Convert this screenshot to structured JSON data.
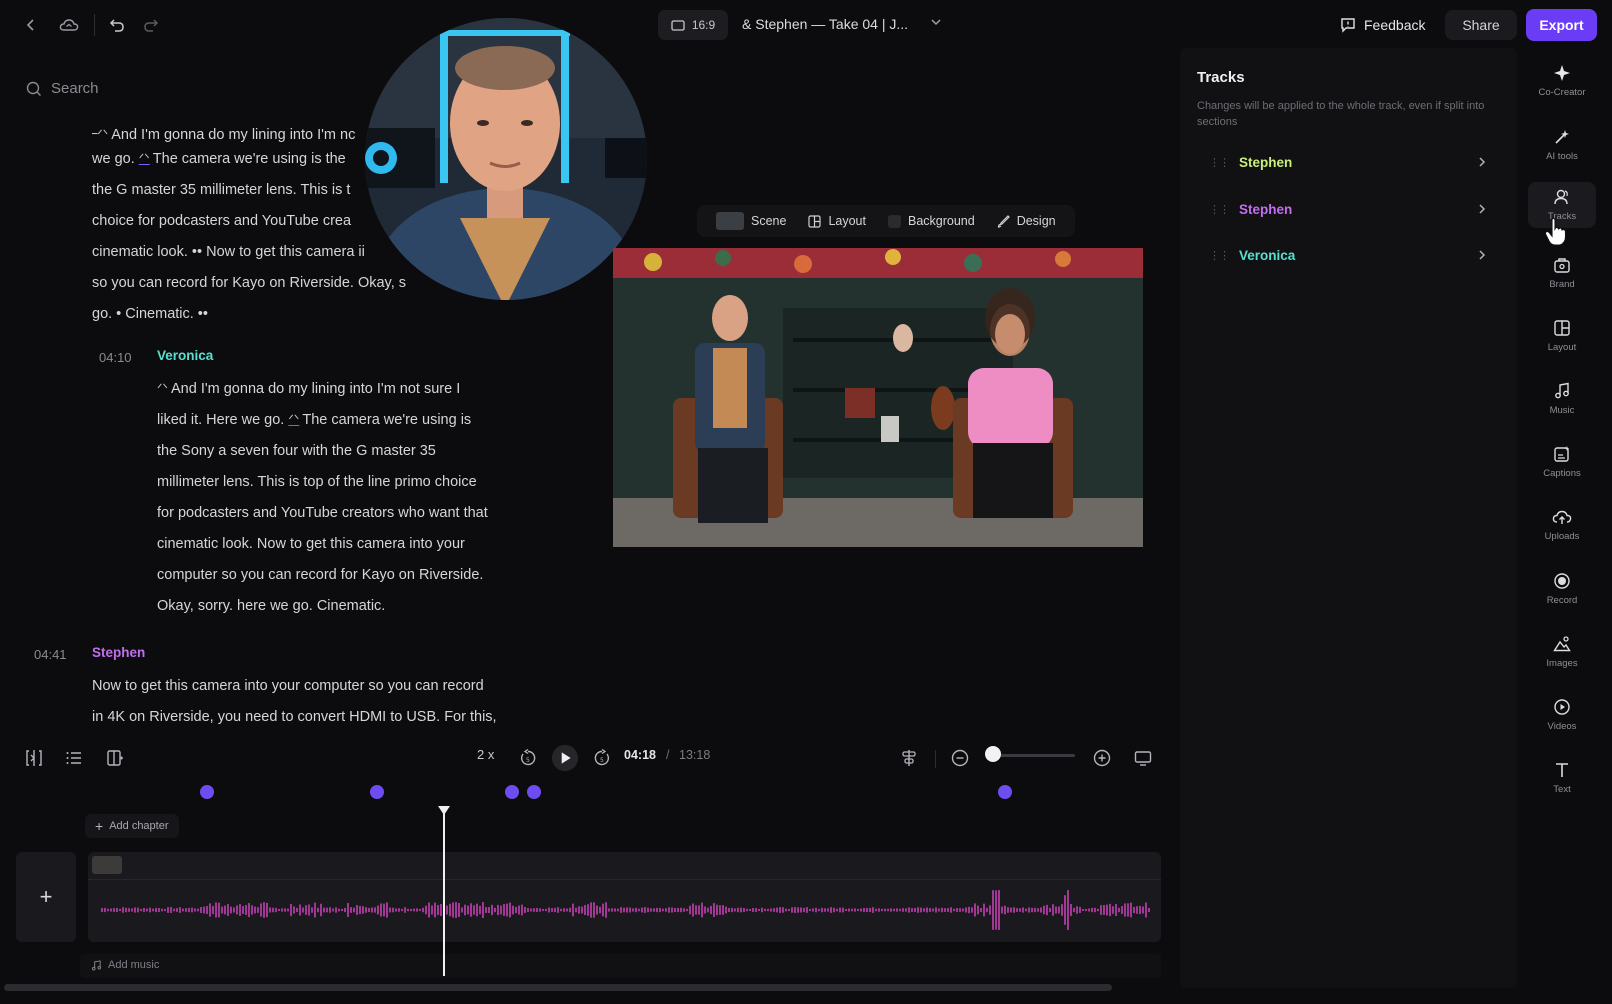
{
  "topbar": {
    "aspect": "16:9",
    "project_title": "& Stephen — Take 04 | J...",
    "feedback": "Feedback",
    "share": "Share",
    "export": "Export"
  },
  "search": {
    "placeholder": "Search"
  },
  "transcript": {
    "block1_lines": [
      "And I'm gonna do my lining into I'm nc",
      "we go.",
      "The camera we're using is the",
      "the G master 35 millimeter lens. This is t",
      "choice for podcasters and YouTube  crea",
      "cinematic look. •• Now to get this camera ii",
      "so you can record for Kayo on Riverside. Okay, s",
      "go. • Cinematic. ••"
    ],
    "block2": {
      "time": "04:10",
      "speaker": "Veronica",
      "lines": [
        "And I'm gonna do my lining into I'm not sure I",
        "liked it. Here we go.",
        "The camera we're using is",
        "the Sony a seven four with the G master 35",
        "millimeter lens. This is top of the line primo choice",
        "for podcasters and YouTube  creators who want that",
        "cinematic look. Now to get this camera into your",
        "computer so you can record for Kayo on Riverside.",
        "Okay, sorry. here we go. Cinematic."
      ]
    },
    "block3": {
      "time": "04:41",
      "speaker": "Stephen",
      "lines": [
        "Now to get this camera into your computer so you can record",
        "in 4K on Riverside, you need to convert HDMI to USB. For this,"
      ]
    }
  },
  "scene_bar": {
    "scene": "Scene",
    "layout": "Layout",
    "background": "Background",
    "design": "Design"
  },
  "tracks": {
    "title": "Tracks",
    "description": "Changes will be applied to the whole track, even if split into sections",
    "items": [
      {
        "name": "Stephen",
        "color": "#c9f07a"
      },
      {
        "name": "Stephen",
        "color": "#c36ef0"
      },
      {
        "name": "Veronica",
        "color": "#58e0cf"
      }
    ]
  },
  "rail": {
    "co_creator": "Co-Creator",
    "ai_tools": "AI tools",
    "tracks": "Tracks",
    "brand": "Brand",
    "layout": "Layout",
    "music": "Music",
    "captions": "Captions",
    "uploads": "Uploads",
    "record": "Record",
    "images": "Images",
    "videos": "Videos",
    "text": "Text"
  },
  "transport": {
    "speed": "2 x",
    "current_time": "04:18",
    "separator": "/",
    "total_time": "13:18",
    "zoom_level": 0.0
  },
  "timeline": {
    "add_chapter": "Add chapter",
    "add_music": "Add music",
    "waveform_color": "#d946c7",
    "marker_color": "#6d4df2"
  },
  "colors": {
    "accent": "#6b3cf5",
    "stephen_green": "#c9f07a",
    "stephen_purple": "#c36ef0",
    "veronica": "#58e0cf"
  }
}
